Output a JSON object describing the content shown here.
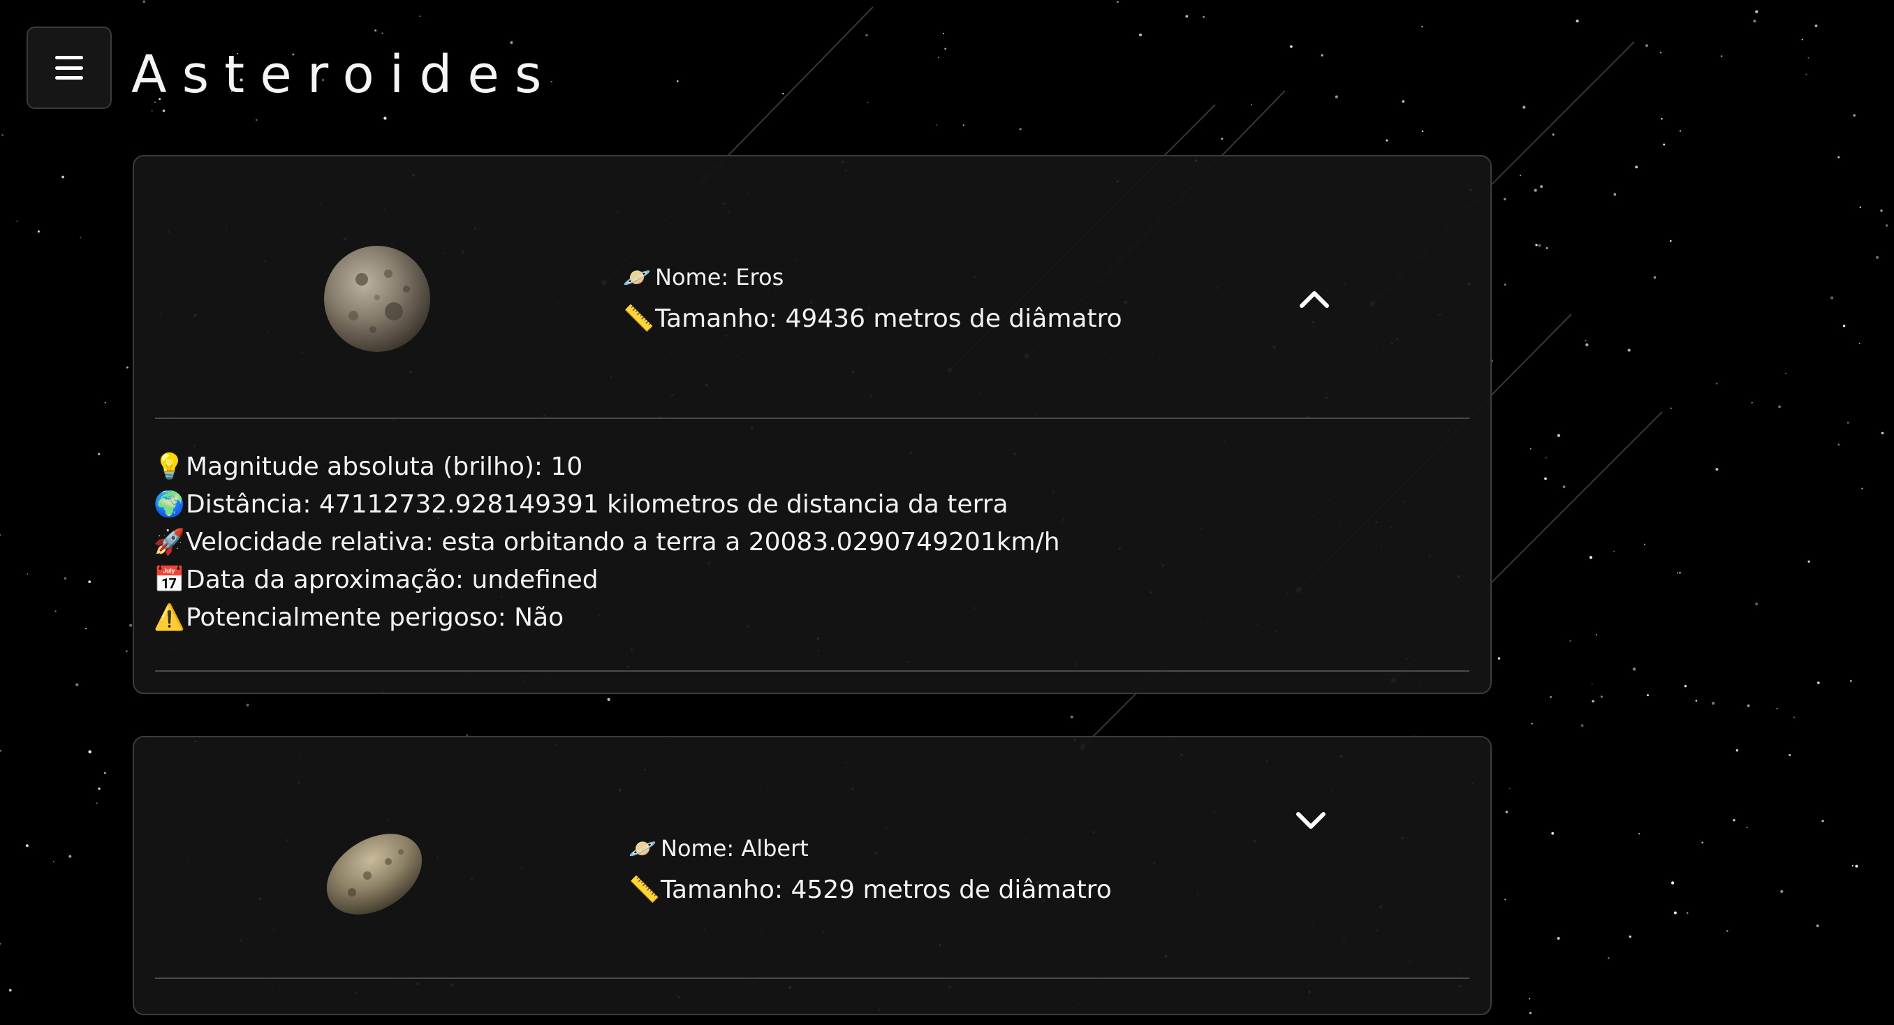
{
  "header": {
    "title": "Asteroides",
    "menu_icon": "hamburger-icon"
  },
  "asteroids": [
    {
      "name_label": "Nome: Eros",
      "size_label": "Tamanho: 49436 metros de diâmatro",
      "expanded": true,
      "toggle_icon": "chevron-up-icon",
      "details": {
        "magnitude": "Magnitude absoluta (brilho): 10",
        "distance": "Distância: 47112732.928149391 kilometros de distancia da terra",
        "velocity": "Velocidade relativa: esta orbitando a terra a 20083.0290749201km/h",
        "approach_date": "Data da aproximação: undefined",
        "hazardous": "Potencialmente perigoso: Não"
      }
    },
    {
      "name_label": "Nome: Albert",
      "size_label": "Tamanho: 4529 metros de diâmatro",
      "expanded": false,
      "toggle_icon": "chevron-down-icon"
    }
  ],
  "icons": {
    "name": "🪐",
    "size": "📏",
    "magnitude": "💡",
    "distance": "🌍",
    "velocity": "🚀",
    "date": "📅",
    "warning": "⚠️"
  },
  "colors": {
    "background": "#000000",
    "card": "#141414",
    "card_border": "#3c3c3c",
    "text": "#f2f2f2"
  }
}
